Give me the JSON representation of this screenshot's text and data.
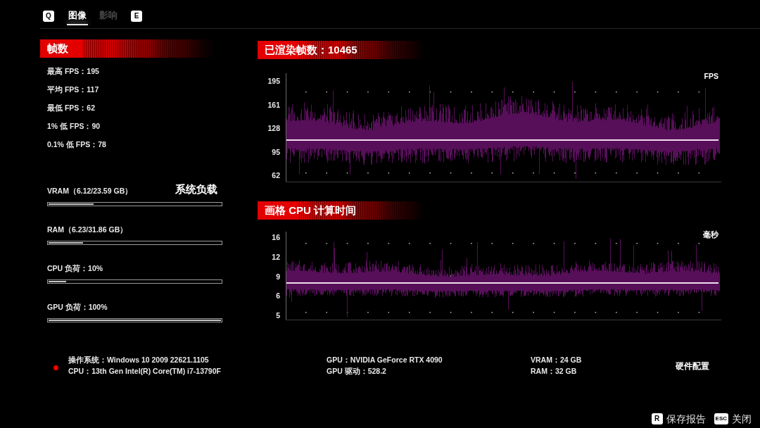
{
  "tabs": {
    "prev_key": "Q",
    "items": [
      {
        "label": "图像",
        "selected": true
      },
      {
        "label": "影响",
        "selected": false
      }
    ],
    "next_key": "E"
  },
  "frame_stats": {
    "title": "帧数",
    "lines": [
      "最高 FPS：195",
      "平均 FPS：117",
      "最低 FPS：62",
      "1% 低 FPS：90",
      "0.1% 低 FPS：78"
    ]
  },
  "system_load": {
    "title": "系统负载",
    "meters": [
      {
        "label": "VRAM（6.12/23.59 GB）",
        "level": 0.26
      },
      {
        "label": "RAM（6.23/31.86 GB）",
        "level": 0.2
      },
      {
        "label": "CPU 负荷：10%",
        "level": 0.1
      },
      {
        "label": "GPU 负荷：100%",
        "level": 1
      }
    ]
  },
  "fps_graph": {
    "title": "已渲染帧数：10465",
    "unit": "FPS",
    "y_tick_labels": [
      "195",
      "161",
      "128",
      "95",
      "62"
    ]
  },
  "cpu_time_graph": {
    "title": "画格 CPU 计算时间",
    "unit": "毫秒",
    "y_tick_labels": [
      "16",
      "12",
      "9",
      "6",
      "5"
    ]
  },
  "hardware": {
    "title": "硬件配置",
    "columns": [
      [
        "操作系统：Windows 10 2009 22621.1105",
        "CPU：13th Gen Intel(R) Core(TM) i7-13790F"
      ],
      [
        "GPU：NVIDIA GeForce RTX 4090",
        "GPU 驱动：528.2"
      ],
      [
        "VRAM：24 GB",
        "RAM：32 GB"
      ]
    ]
  },
  "footer_actions": [
    {
      "key": "R",
      "label": "保存报告"
    },
    {
      "key": "ESC",
      "label": "关闭"
    }
  ]
}
